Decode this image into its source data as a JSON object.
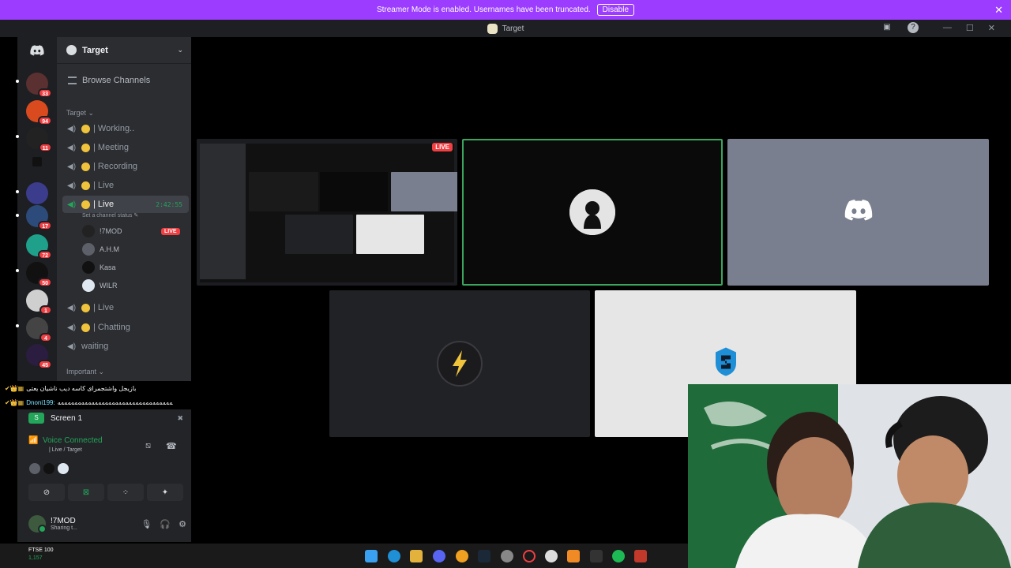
{
  "banner": {
    "text": "Streamer Mode is enabled. Usernames have been truncated.",
    "disable_label": "Disable",
    "close": "✕"
  },
  "titlebar": {
    "title": "Target",
    "inbox": "▣",
    "help": "?",
    "min": "—",
    "max": "☐",
    "close": "✕"
  },
  "rail": {
    "badges": [
      "33",
      "94",
      "11",
      "",
      "",
      "17",
      "72",
      "50",
      "1",
      "4",
      "45"
    ]
  },
  "sidebar": {
    "server_name": "Target",
    "chevron": "⌄",
    "browse_label": "Browse Channels",
    "category_target": "Target ⌄",
    "category_important": "Important ⌄",
    "channels": [
      {
        "name": "| Working..",
        "icon": "speaker-icon"
      },
      {
        "name": "| Meeting",
        "icon": "speaker-icon"
      },
      {
        "name": "| Recording",
        "icon": "speaker-icon"
      },
      {
        "name": "| Live",
        "icon": "speaker-icon"
      },
      {
        "name": "| Live",
        "icon": "speaker-icon",
        "active": true,
        "timer": "2:42:55"
      },
      {
        "name": "| Live",
        "icon": "speaker-icon"
      },
      {
        "name": "| Chatting",
        "icon": "speaker-icon"
      },
      {
        "name": "waiting",
        "icon": "speaker-icon"
      }
    ],
    "channel_status": "Set a channel status ✎",
    "voice_users": [
      {
        "name": "!7MOD",
        "live": "LIVE"
      },
      {
        "name": "A.H.M"
      },
      {
        "name": "Kasa"
      },
      {
        "name": "WILR"
      }
    ]
  },
  "chat": [
    {
      "badges": "✔👑▦",
      "user": "",
      "text": "بازیجل واشتجمرای کاسه دیب ناشیان یعتی"
    },
    {
      "badges": "✔👑▦",
      "user": "Dnoni199:",
      "text": "ﻪﻪﻪﻪﻪﻪﻪﻪﻪﻪﻪﻪﻪﻪﻪﻪﻪﻪﻪﻪﻪﻪﻪﻪﻪﻪﻪﻪﻪﻪﻪﻪﻪﻪ"
    }
  ],
  "panel": {
    "screen_label": "Screen 1",
    "screen_close": "✖",
    "voice_connected": "Voice Connected",
    "voice_sub": "| Live / Target",
    "username": "!7MOD",
    "user_status": "Sharing t...",
    "buttons": [
      "⊘",
      "⊠",
      "⁘",
      "✦"
    ]
  },
  "stage": {
    "live_tag": "LIVE"
  },
  "taskbar": {
    "ticker": "FTSE 100",
    "value": "1,157"
  },
  "colors": {
    "accent_green": "#23a55a",
    "live_red": "#f23f43",
    "banner": "#9b3cff"
  }
}
